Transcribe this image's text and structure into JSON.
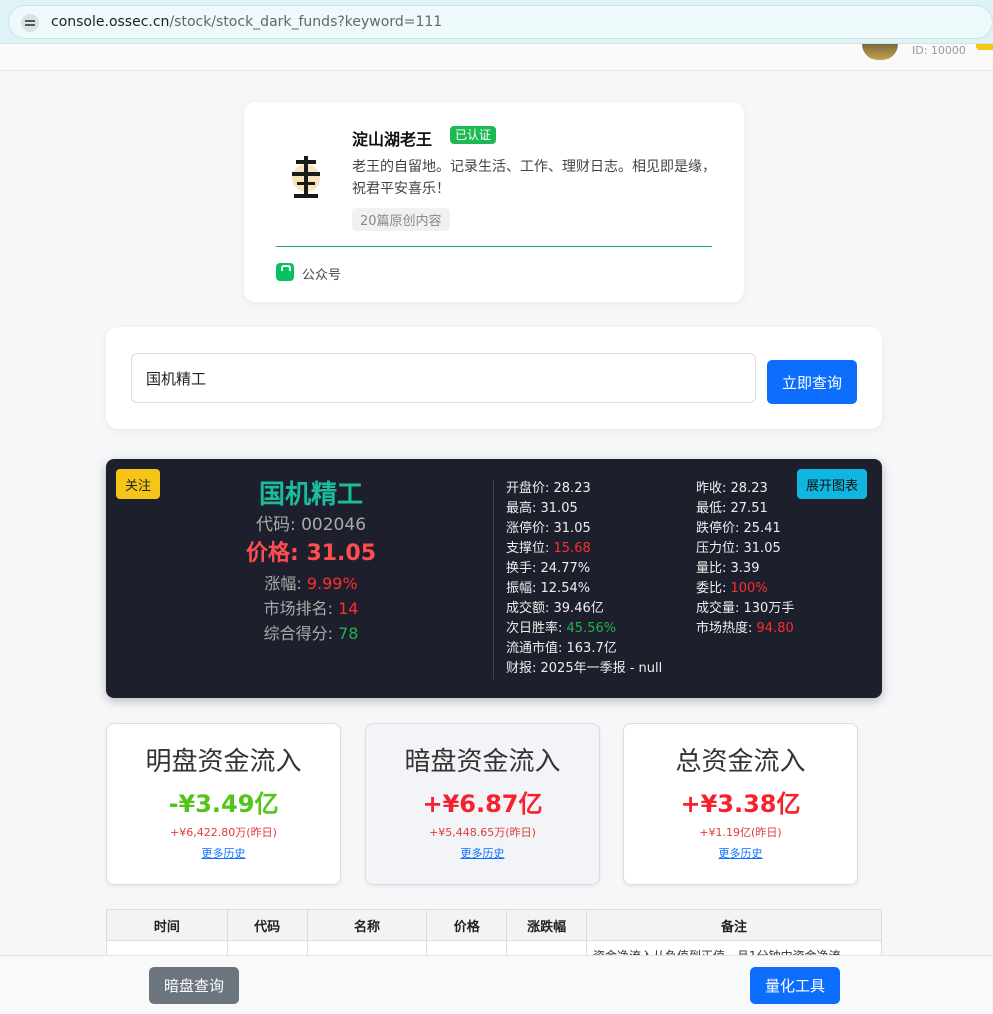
{
  "browser": {
    "url_host": "console.ossec.cn",
    "url_path": "/stock/stock_dark_funds?keyword=111"
  },
  "user": {
    "id_label": "ID: 10000"
  },
  "profile": {
    "name": "淀山湖老王",
    "badge": "已认证",
    "desc": "老王的自留地。记录生活、工作、理财日志。相见即是缘，祝君平安喜乐！",
    "tag": "20篇原创内容",
    "channel": "公众号"
  },
  "search": {
    "value": "国机精工",
    "button": "立即查询"
  },
  "stock": {
    "follow": "关注",
    "expand": "展开图表",
    "name": "国机精工",
    "code_label": "代码: ",
    "code": "002046",
    "price_label": "价格: ",
    "price": "31.05",
    "change_label": "涨幅: ",
    "change": "9.99%",
    "rank_label": "市场排名: ",
    "rank": "14",
    "score_label": "综合得分: ",
    "score": "78",
    "open_label": "开盘价: ",
    "open": "28.23",
    "high_label": "最高: ",
    "high": "31.05",
    "limitup_label": "涨停价: ",
    "limitup": "31.05",
    "support_label": "支撑位: ",
    "support": "15.68",
    "turnover_label": "换手: ",
    "turnover": "24.77%",
    "amplitude_label": "振幅: ",
    "amplitude": "12.54%",
    "amount_label": "成交额: ",
    "amount": "39.46亿",
    "winrate_label": "次日胜率: ",
    "winrate": "45.56%",
    "mcap_label": "流通市值: ",
    "mcap": "163.7亿",
    "report_label": "财报: ",
    "report": "2025年一季报 - null",
    "prevclose_label": "昨收: ",
    "prevclose": "28.23",
    "low_label": "最低: ",
    "low": "27.51",
    "limitdown_label": "跌停价: ",
    "limitdown": "25.41",
    "pressure_label": "压力位: ",
    "pressure": "31.05",
    "volratio_label": "量比: ",
    "volratio": "3.39",
    "commit_label": "委比: ",
    "commit": "100%",
    "volume_label": "成交量: ",
    "volume": "130万手",
    "heat_label": "市场热度: ",
    "heat": "94.80"
  },
  "flows": [
    {
      "title": "明盘资金流入",
      "value": "-¥3.49亿",
      "yday": "+¥6,422.80万(昨日)",
      "more": "更多历史",
      "color": "#52c41a"
    },
    {
      "title": "暗盘资金流入",
      "value": "+¥6.87亿",
      "yday": "+¥5,448.65万(昨日)",
      "more": "更多历史",
      "color": "#f5222d"
    },
    {
      "title": "总资金流入",
      "value": "+¥3.38亿",
      "yday": "+¥1.19亿(昨日)",
      "more": "更多历史",
      "color": "#f5222d"
    }
  ],
  "table": {
    "headers": [
      "时间",
      "代码",
      "名称",
      "价格",
      "涨跌幅",
      "备注"
    ],
    "row_note": "资金净流入从负值到正值，且1分钟内资金净流"
  },
  "bottom": {
    "dark_query": "暗盘查询",
    "quant_tool": "量化工具"
  }
}
